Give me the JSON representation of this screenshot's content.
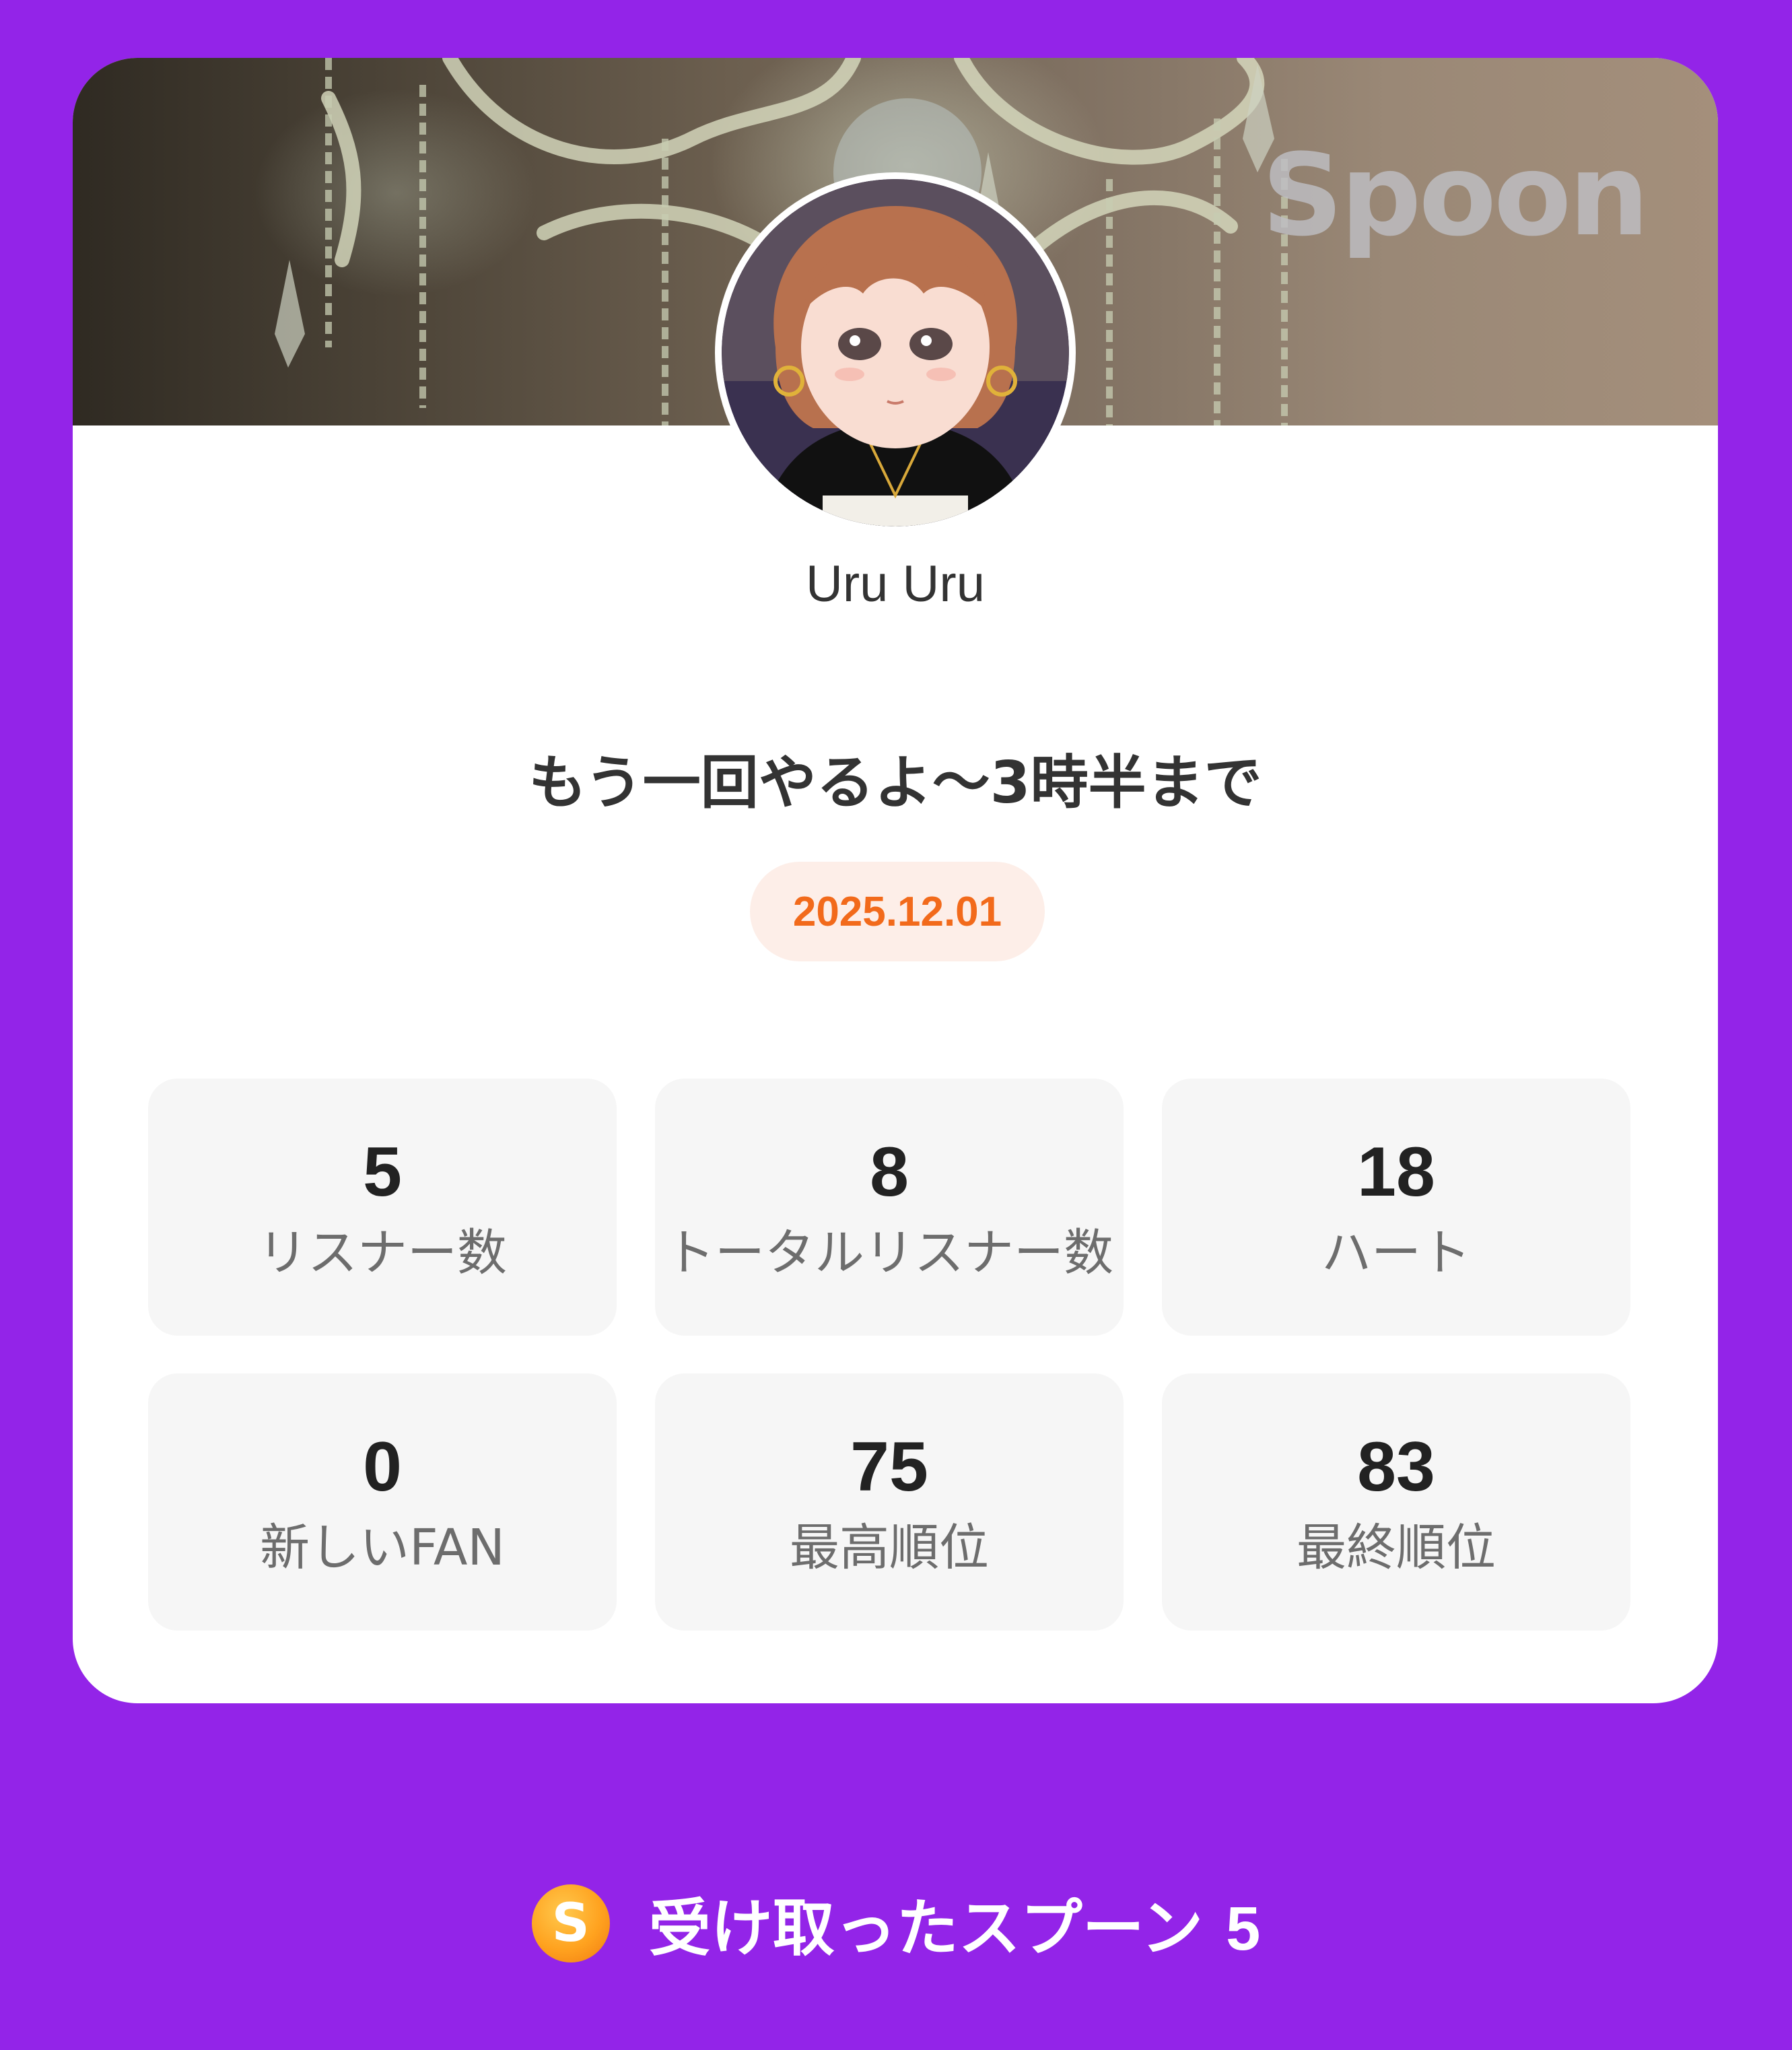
{
  "banner": {
    "brand": "Spoon"
  },
  "profile": {
    "username": "Uru Uru"
  },
  "live": {
    "title": "もう一回やるよ～3時半まで",
    "date": "2025.12.01"
  },
  "stats": [
    {
      "value": "5",
      "label": "リスナー数"
    },
    {
      "value": "8",
      "label": "トータルリスナー数"
    },
    {
      "value": "18",
      "label": "ハート"
    },
    {
      "value": "0",
      "label": "新しいFAN"
    },
    {
      "value": "75",
      "label": "最高順位"
    },
    {
      "value": "83",
      "label": "最終順位"
    }
  ],
  "footer": {
    "coin_icon": "spoon-coin-icon",
    "coin_letter": "S",
    "label": "受け取ったスプーン",
    "count": "5"
  },
  "colors": {
    "background": "#9324e8",
    "card": "#ffffff",
    "date_text": "#f26a1b",
    "date_bg": "#fdeee8",
    "stat_bg": "#f6f6f6"
  }
}
